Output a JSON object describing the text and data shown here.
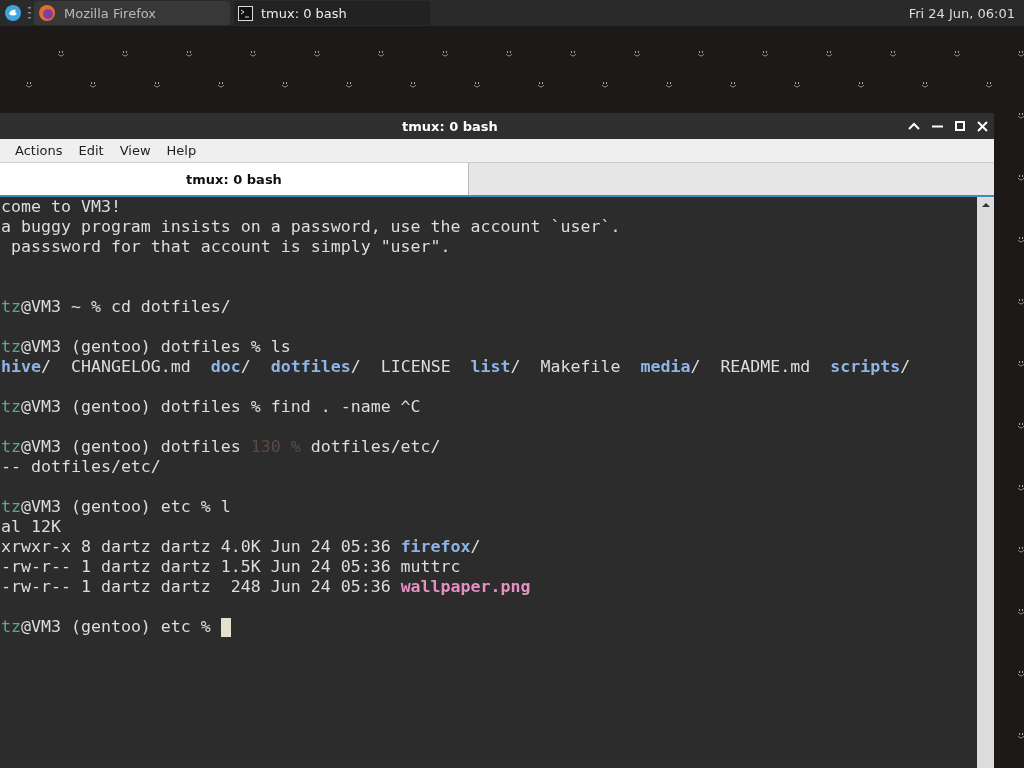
{
  "panel": {
    "tasks": [
      {
        "label": "Mozilla Firefox",
        "kind": "browser",
        "selected": false
      },
      {
        "label": "tmux: 0 bash",
        "kind": "terminal",
        "selected": true
      }
    ],
    "clock": "Fri 24 Jun, 06:01"
  },
  "window": {
    "title": "tmux: 0 bash",
    "menu": [
      "Actions",
      "Edit",
      "View",
      "Help"
    ],
    "tabs": [
      {
        "label": "tmux: 0 bash",
        "selected": true
      }
    ]
  },
  "terminal": {
    "lines": [
      {
        "kind": "text",
        "segments": [
          {
            "kind": "plain",
            "text": "come to VM3!"
          }
        ]
      },
      {
        "kind": "text",
        "segments": [
          {
            "kind": "plain",
            "text": "a buggy program insists on a password, use the account `user`."
          }
        ]
      },
      {
        "kind": "text",
        "segments": [
          {
            "kind": "plain",
            "text": " passsword for that account is simply \"user\"."
          }
        ]
      },
      {
        "kind": "blank"
      },
      {
        "kind": "blank"
      },
      {
        "kind": "text",
        "segments": [
          {
            "kind": "user",
            "text": "tz"
          },
          {
            "kind": "plain",
            "text": "@VM3 ~ % cd dotfiles/"
          }
        ]
      },
      {
        "kind": "blank"
      },
      {
        "kind": "text",
        "segments": [
          {
            "kind": "user",
            "text": "tz"
          },
          {
            "kind": "plain",
            "text": "@VM3 (gentoo) dotfiles % ls"
          }
        ]
      },
      {
        "kind": "text",
        "segments": [
          {
            "kind": "dir",
            "text": "hive"
          },
          {
            "kind": "plain",
            "text": "/  CHANGELOG.md  "
          },
          {
            "kind": "dir",
            "text": "doc"
          },
          {
            "kind": "plain",
            "text": "/  "
          },
          {
            "kind": "dir",
            "text": "dotfiles"
          },
          {
            "kind": "plain",
            "text": "/  LICENSE  "
          },
          {
            "kind": "dir",
            "text": "list"
          },
          {
            "kind": "plain",
            "text": "/  Makefile  "
          },
          {
            "kind": "dir",
            "text": "media"
          },
          {
            "kind": "plain",
            "text": "/  README.md  "
          },
          {
            "kind": "dir",
            "text": "scripts"
          },
          {
            "kind": "plain",
            "text": "/"
          }
        ]
      },
      {
        "kind": "blank"
      },
      {
        "kind": "text",
        "segments": [
          {
            "kind": "user",
            "text": "tz"
          },
          {
            "kind": "plain",
            "text": "@VM3 (gentoo) dotfiles % find . -name ^C"
          }
        ]
      },
      {
        "kind": "blank"
      },
      {
        "kind": "text",
        "segments": [
          {
            "kind": "user",
            "text": "tz"
          },
          {
            "kind": "plain",
            "text": "@VM3 (gentoo) dotfiles "
          },
          {
            "kind": "dim",
            "text": "130 %"
          },
          {
            "kind": "plain",
            "text": " dotfiles/etc/"
          }
        ]
      },
      {
        "kind": "text",
        "segments": [
          {
            "kind": "plain",
            "text": "-- dotfiles/etc/"
          }
        ]
      },
      {
        "kind": "blank"
      },
      {
        "kind": "text",
        "segments": [
          {
            "kind": "user",
            "text": "tz"
          },
          {
            "kind": "plain",
            "text": "@VM3 (gentoo) etc % l"
          }
        ]
      },
      {
        "kind": "text",
        "segments": [
          {
            "kind": "plain",
            "text": "al 12K"
          }
        ]
      },
      {
        "kind": "text",
        "segments": [
          {
            "kind": "plain",
            "text": "xrwxr-x 8 dartz dartz 4.0K Jun 24 05:36 "
          },
          {
            "kind": "dir",
            "text": "firefox"
          },
          {
            "kind": "plain",
            "text": "/"
          }
        ]
      },
      {
        "kind": "text",
        "segments": [
          {
            "kind": "plain",
            "text": "-rw-r-- 1 dartz dartz 1.5K Jun 24 05:36 muttrc"
          }
        ]
      },
      {
        "kind": "text",
        "segments": [
          {
            "kind": "plain",
            "text": "-rw-r-- 1 dartz dartz  248 Jun 24 05:36 "
          },
          {
            "kind": "image",
            "text": "wallpaper.png"
          }
        ]
      },
      {
        "kind": "blank"
      },
      {
        "kind": "prompt",
        "segments": [
          {
            "kind": "user",
            "text": "tz"
          },
          {
            "kind": "plain",
            "text": "@VM3 (gentoo) etc % "
          }
        ]
      }
    ]
  }
}
